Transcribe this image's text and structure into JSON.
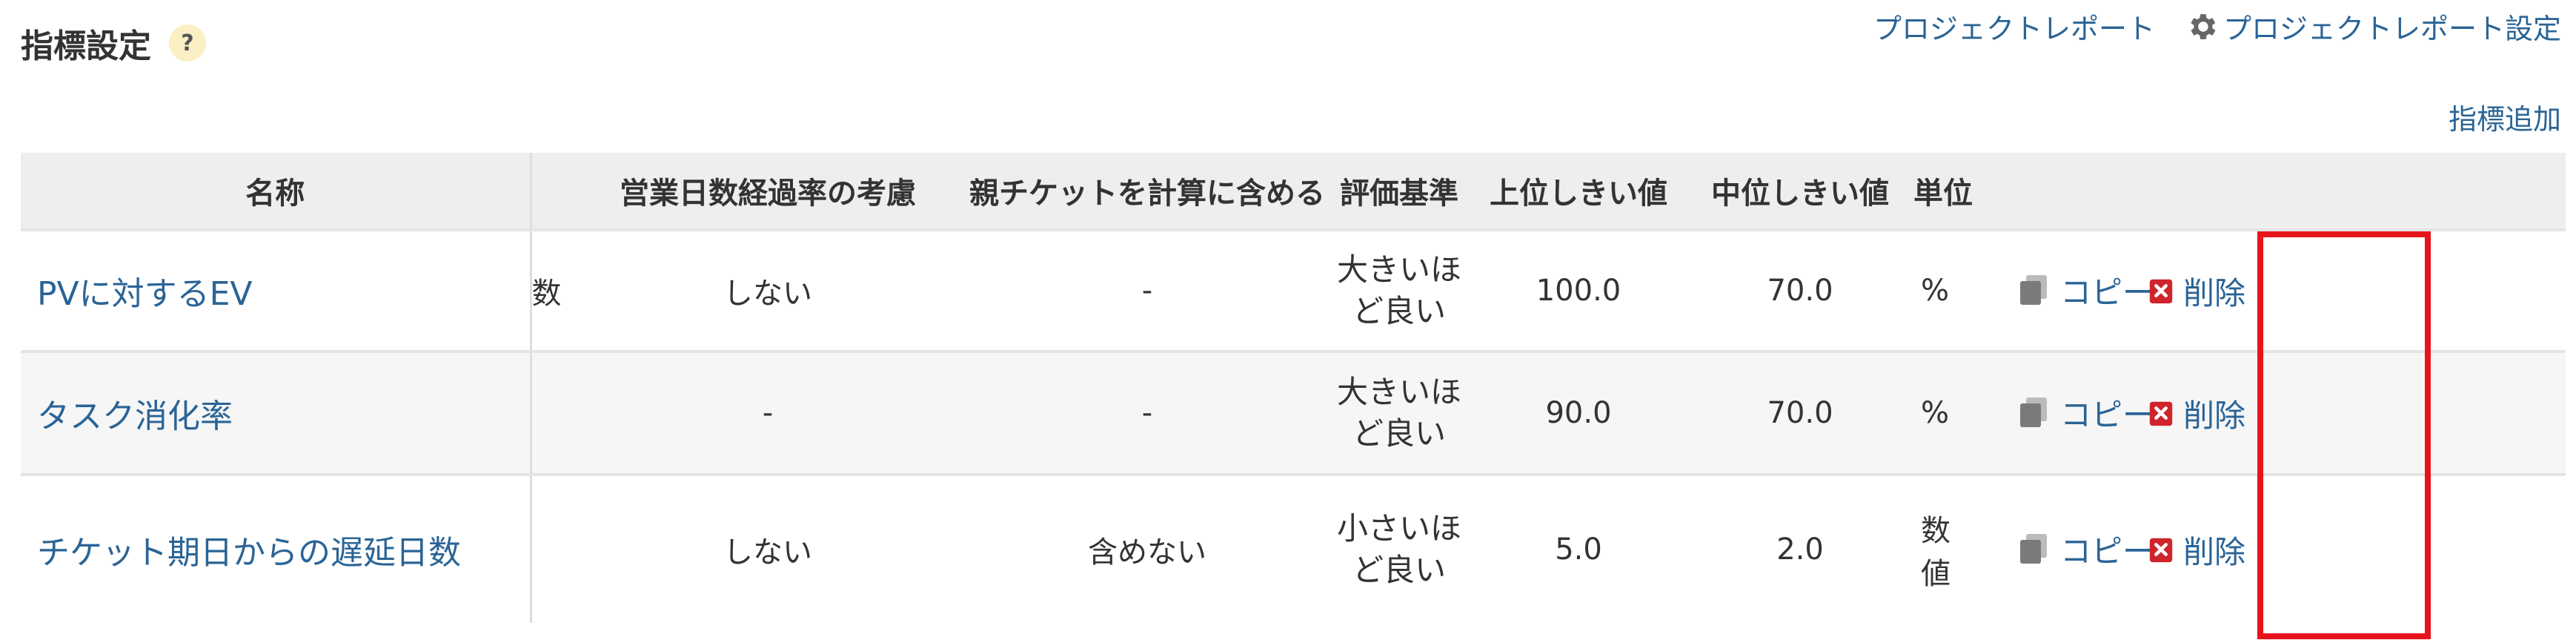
{
  "header": {
    "title": "指標設定",
    "help_label": "?",
    "project_report_link": "プロジェクトレポート",
    "project_report_settings_link": "プロジェクトレポート設定",
    "add_metric_link": "指標追加"
  },
  "table": {
    "columns": [
      "名称",
      "",
      "営業日数経過率の考慮",
      "親チケットを計算に含める",
      "評価基準",
      "上位しきい値",
      "中位しきい値",
      "単位",
      "",
      ""
    ],
    "rows": [
      {
        "name": "PVに対するEV",
        "truncated": "数",
        "business_days": "しない",
        "parent_ticket": "-",
        "criteria_line1": "大きいほ",
        "criteria_line2": "ど良い",
        "upper": "100.0",
        "middle": "70.0",
        "unit": "%",
        "copy": "コピー",
        "delete": "削除"
      },
      {
        "name": "タスク消化率",
        "truncated": "",
        "business_days": "-",
        "parent_ticket": "-",
        "criteria_line1": "大きいほ",
        "criteria_line2": "ど良い",
        "upper": "90.0",
        "middle": "70.0",
        "unit": "%",
        "copy": "コピー",
        "delete": "削除"
      },
      {
        "name": "チケット期日からの遅延日数",
        "truncated": "",
        "business_days": "しない",
        "parent_ticket": "含めない",
        "criteria_line1": "小さいほ",
        "criteria_line2": "ど良い",
        "upper": "5.0",
        "middle": "2.0",
        "unit": "数値",
        "copy": "コピー",
        "delete": "削除"
      }
    ]
  },
  "colors": {
    "link": "#2a6496",
    "highlight": "#e8141c",
    "header_bg": "#eeeeee",
    "delete_icon": "#d0242b"
  },
  "icons": {
    "help": "question-icon",
    "settings": "gear-icon",
    "copy": "copy-icon",
    "delete": "delete-icon"
  }
}
